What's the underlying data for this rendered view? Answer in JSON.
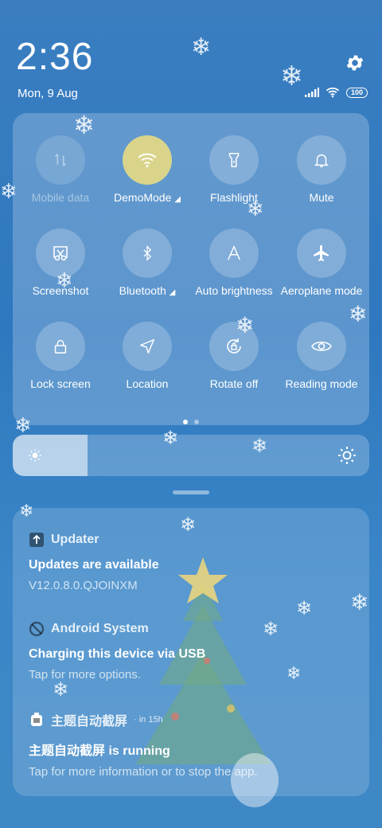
{
  "status": {
    "time": "2:36",
    "date": "Mon, 9 Aug",
    "battery": "100"
  },
  "quick_settings": {
    "tiles": [
      {
        "label": "Mobile data",
        "icon": "mobile-data-icon",
        "active": false,
        "disabled": true
      },
      {
        "label": "DemoMode",
        "icon": "wifi-icon",
        "active": true,
        "expandable": true
      },
      {
        "label": "Flashlight",
        "icon": "flashlight-icon",
        "active": false
      },
      {
        "label": "Mute",
        "icon": "bell-icon",
        "active": false
      },
      {
        "label": "Screenshot",
        "icon": "screenshot-icon",
        "active": false
      },
      {
        "label": "Bluetooth",
        "icon": "bluetooth-icon",
        "active": false,
        "expandable": true
      },
      {
        "label": "Auto brightness",
        "icon": "auto-brightness-icon",
        "active": false
      },
      {
        "label": "Aeroplane mode",
        "icon": "airplane-icon",
        "active": false
      },
      {
        "label": "Lock screen",
        "icon": "lock-icon",
        "active": false
      },
      {
        "label": "Location",
        "icon": "location-icon",
        "active": false
      },
      {
        "label": "Rotate off",
        "icon": "rotate-lock-icon",
        "active": false
      },
      {
        "label": "Reading mode",
        "icon": "eye-icon",
        "active": false
      }
    ],
    "page_current": 1,
    "page_count": 2
  },
  "brightness": {
    "level": 0.21
  },
  "notifications": [
    {
      "app": "Updater",
      "time": "",
      "title": "Updates are available",
      "body": "V12.0.8.0.QJOINXM",
      "icon": "updater-icon"
    },
    {
      "app": "Android System",
      "time": "",
      "title": "Charging this device via USB",
      "body": "Tap for more options.",
      "icon": "android-system-icon"
    },
    {
      "app": "主题自动截屏",
      "time": "· in 15h",
      "title": "主题自动截屏 is running",
      "body": "Tap for more information or to stop the app.",
      "icon": "theme-screenshot-icon"
    }
  ],
  "colors": {
    "active_tile": "#d9d48a",
    "background": "#3a7ec0"
  }
}
